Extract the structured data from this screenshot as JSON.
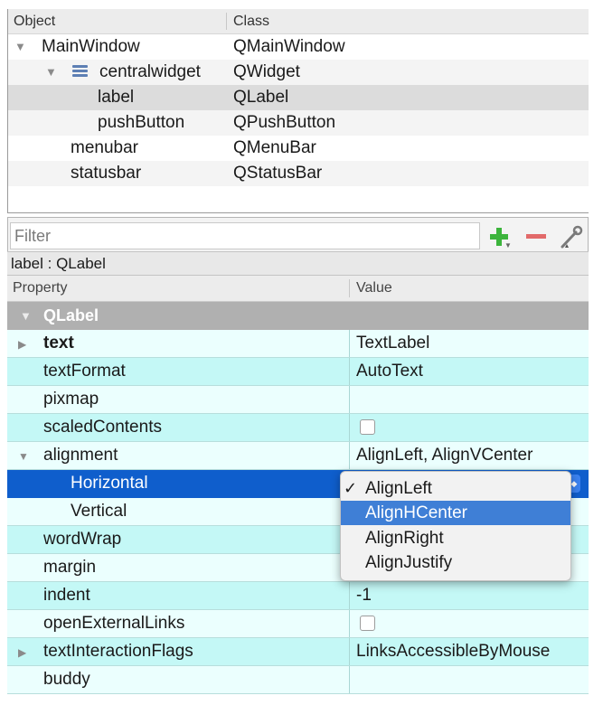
{
  "object_inspector": {
    "header": {
      "object": "Object",
      "class": "Class"
    },
    "rows": [
      {
        "name": "MainWindow",
        "class": "QMainWindow",
        "expanded": true
      },
      {
        "name": "centralwidget",
        "class": "QWidget",
        "expanded": true,
        "icon": "layout-icon"
      },
      {
        "name": "label",
        "class": "QLabel",
        "selected": true
      },
      {
        "name": "pushButton",
        "class": "QPushButton"
      },
      {
        "name": "menubar",
        "class": "QMenuBar"
      },
      {
        "name": "statusbar",
        "class": "QStatusBar"
      }
    ]
  },
  "property_editor": {
    "filter_placeholder": "Filter",
    "toolbar_icons": [
      "plus-icon",
      "minus-icon",
      "wrench-icon"
    ],
    "object_label": "label : QLabel",
    "header": {
      "property": "Property",
      "value": "Value"
    },
    "group": {
      "name": "QLabel"
    },
    "rows": [
      {
        "name": "text",
        "value": "TextLabel",
        "bold": true,
        "expandable": true
      },
      {
        "name": "textFormat",
        "value": "AutoText"
      },
      {
        "name": "pixmap",
        "value": ""
      },
      {
        "name": "scaledContents",
        "checkbox": true,
        "checked": false
      },
      {
        "name": "alignment",
        "value": "AlignLeft, AlignVCenter",
        "expanded": true
      },
      {
        "name": "Horizontal",
        "value": "",
        "selected": true
      },
      {
        "name": "Vertical",
        "value": ""
      },
      {
        "name": "wordWrap",
        "value": ""
      },
      {
        "name": "margin",
        "value": ""
      },
      {
        "name": "indent",
        "value": "-1"
      },
      {
        "name": "openExternalLinks",
        "checkbox": true,
        "checked": false
      },
      {
        "name": "textInteractionFlags",
        "value": "LinksAccessibleByMouse",
        "expandable": true
      },
      {
        "name": "buddy",
        "value": ""
      }
    ]
  },
  "popup_menu": {
    "items": [
      {
        "label": "AlignLeft",
        "checked": true
      },
      {
        "label": "AlignHCenter",
        "highlighted": true
      },
      {
        "label": "AlignRight"
      },
      {
        "label": "AlignJustify"
      }
    ]
  },
  "colors": {
    "row_light": "#ebfffe",
    "row_dark": "#c4f8f6",
    "selection": "#0f5ecc",
    "menu_highlight": "#3f7fd6",
    "group_header": "#b0b0b0"
  }
}
